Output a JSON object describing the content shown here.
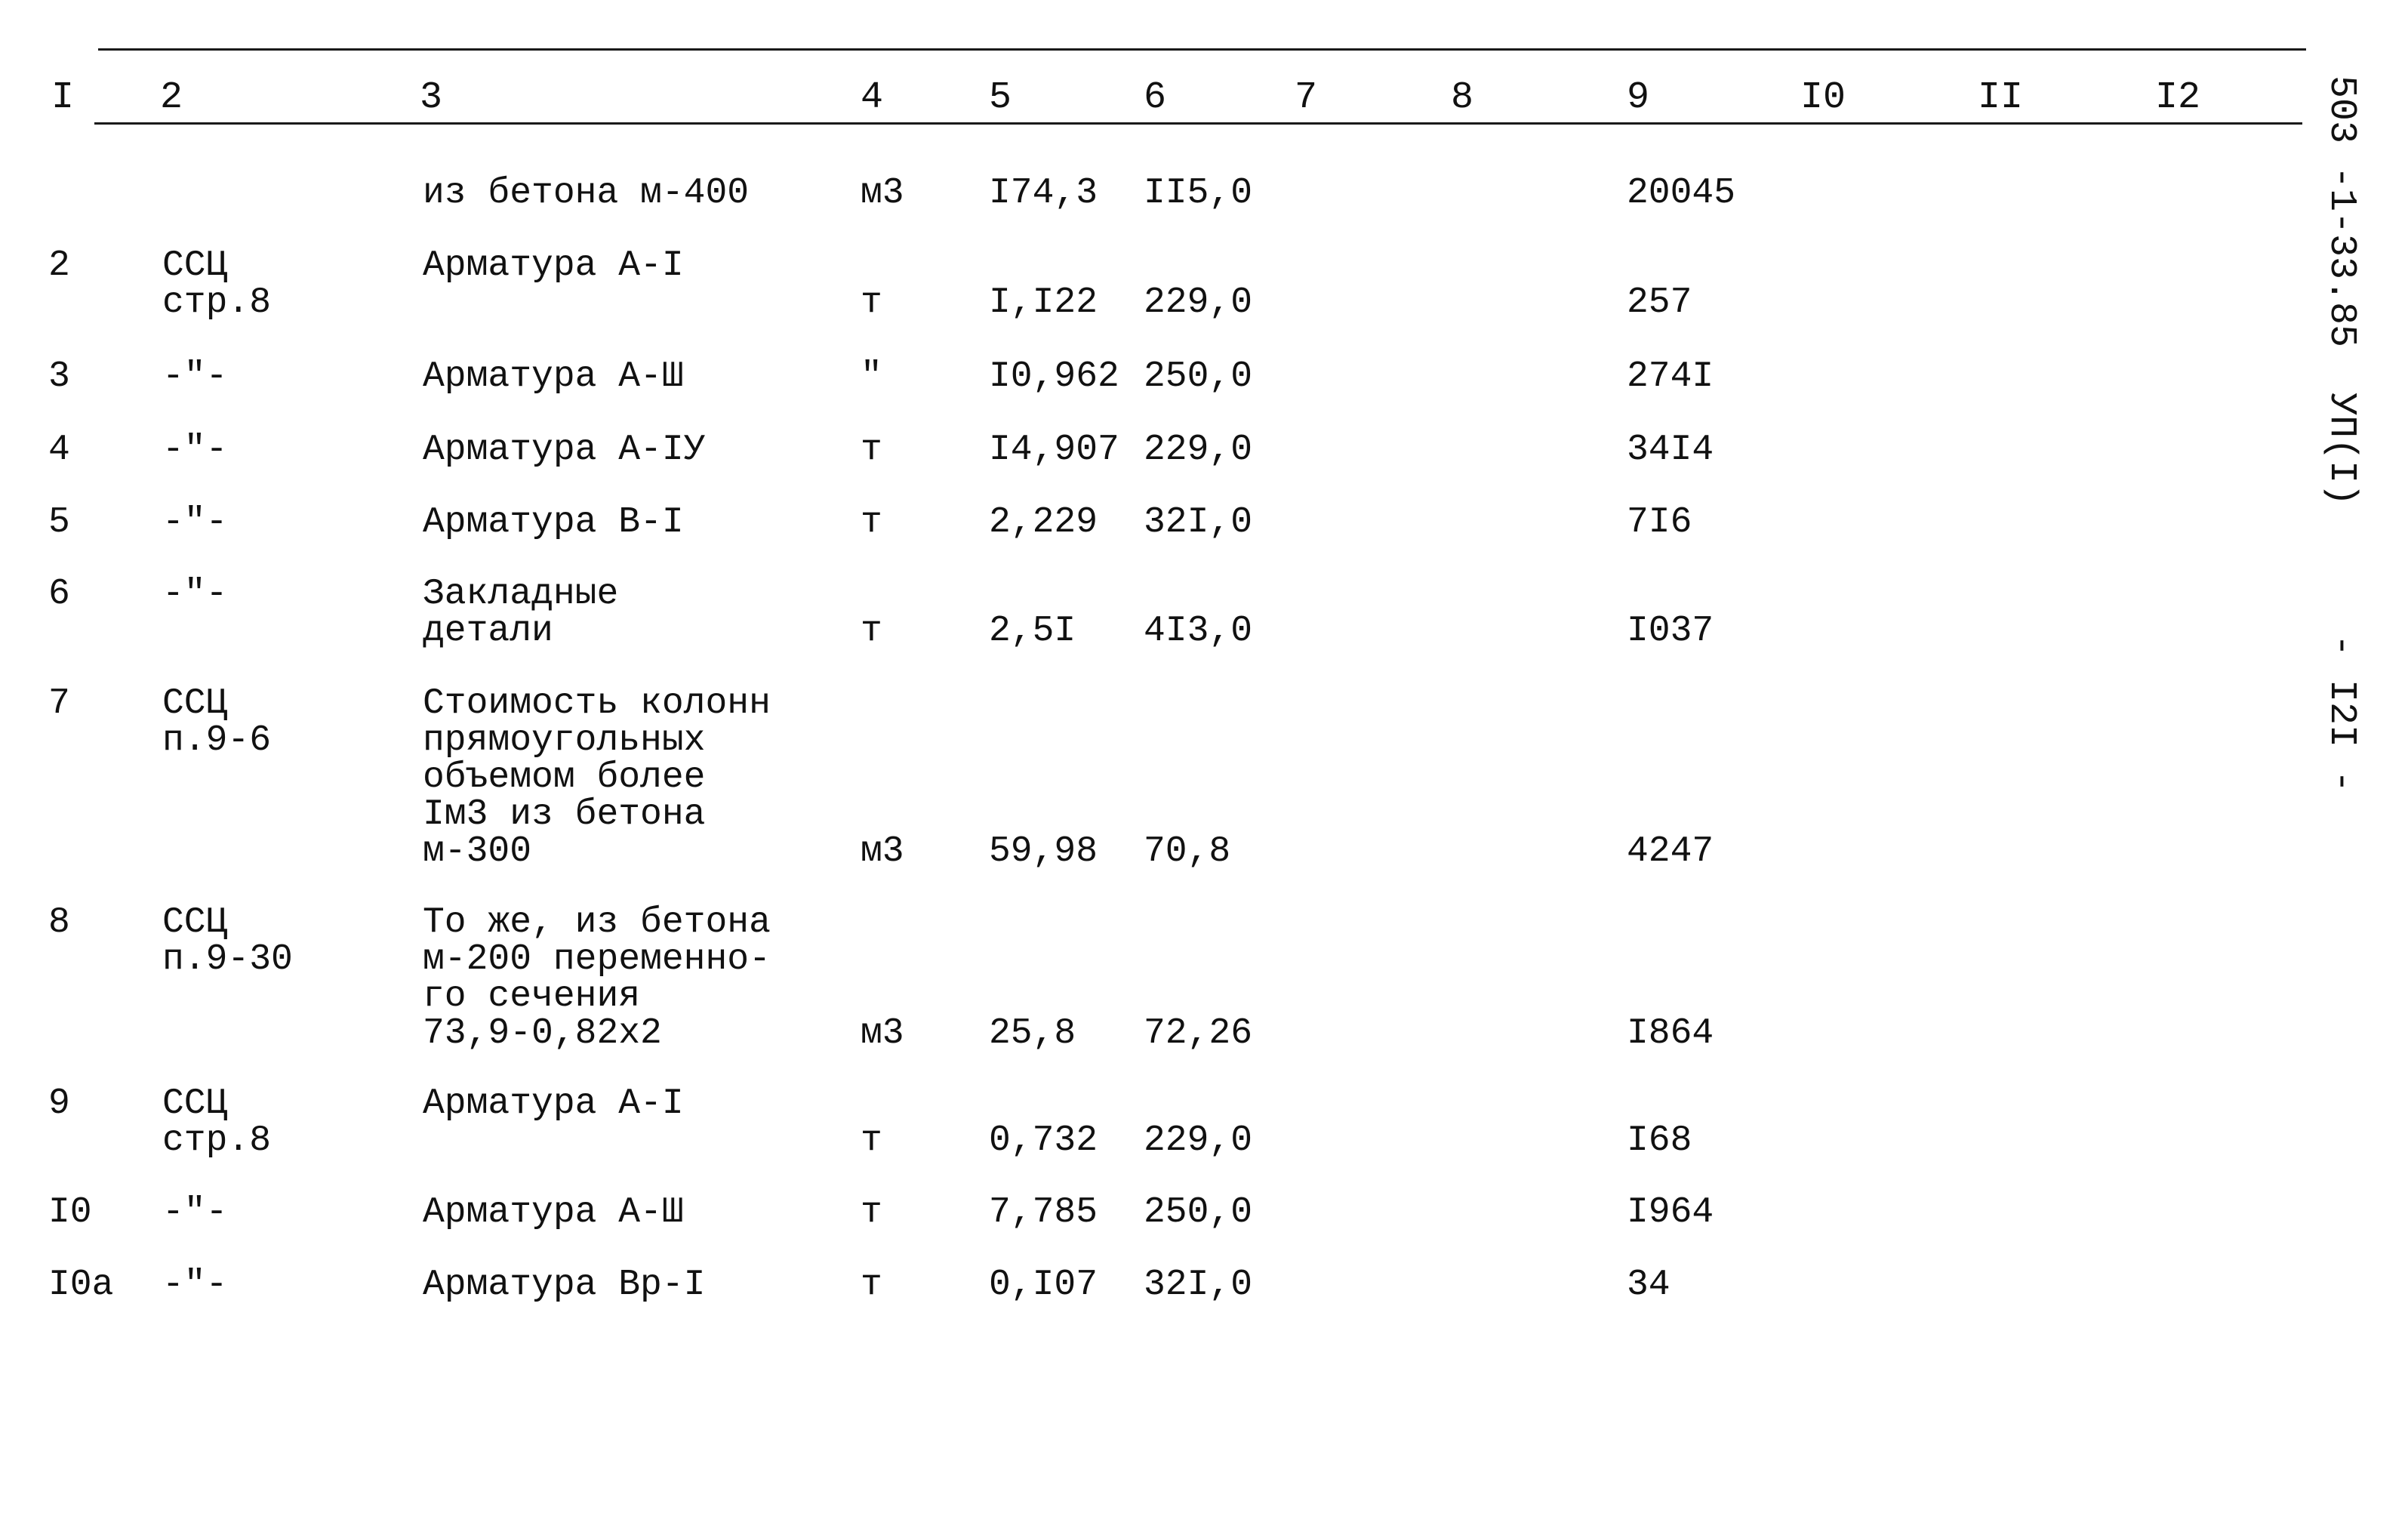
{
  "document": {
    "side_code": "503 -1-33.85  УП(I)",
    "page_number": "- I2I -",
    "column_headers": [
      "I",
      "2",
      "3",
      "4",
      "5",
      "6",
      "7",
      "8",
      "9",
      "I0",
      "II",
      "I2"
    ],
    "rows": [
      {
        "num": "",
        "ref": "",
        "name": "из бетона м-400",
        "unit": "м3",
        "qty": "I74,3",
        "price": "II5,0",
        "total": "20045"
      },
      {
        "num": "2",
        "ref": "ССЦ\nстр.8",
        "name": "Арматура А-I",
        "unit": "т",
        "qty": "I,I22",
        "price": "229,0",
        "total": "257"
      },
      {
        "num": "3",
        "ref": "-\"-",
        "name": "Арматура А-Ш",
        "unit": "\"",
        "qty": "I0,962",
        "price": "250,0",
        "total": "274I"
      },
      {
        "num": "4",
        "ref": "-\"-",
        "name": "Арматура А-IУ",
        "unit": "т",
        "qty": "I4,907",
        "price": "229,0",
        "total": "34I4"
      },
      {
        "num": "5",
        "ref": "-\"-",
        "name": "Арматура В-I",
        "unit": "т",
        "qty": "2,229",
        "price": "32I,0",
        "total": "7I6"
      },
      {
        "num": "6",
        "ref": "-\"-",
        "name": "Закладные\nдетали",
        "unit": "т",
        "qty": "2,5I",
        "price": "4I3,0",
        "total": "I037"
      },
      {
        "num": "7",
        "ref": "ССЦ\nп.9-6",
        "name": "Стоимость колонн\nпрямоугольных\nобъемом более\nIм3 из бетона\nм-300",
        "unit": "м3",
        "qty": "59,98",
        "price": "70,8",
        "total": "4247"
      },
      {
        "num": "8",
        "ref": "ССЦ\nп.9-30",
        "name": "То же, из бетона\nм-200 переменно-\nго сечения\n73,9-0,82х2",
        "unit": "м3",
        "qty": "25,8",
        "price": "72,26",
        "total": "I864"
      },
      {
        "num": "9",
        "ref": "ССЦ\nстр.8",
        "name": "Арматура А-I",
        "unit": "т",
        "qty": "0,732",
        "price": "229,0",
        "total": "I68"
      },
      {
        "num": "I0",
        "ref": "-\"-",
        "name": "Арматура А-Ш",
        "unit": "т",
        "qty": "7,785",
        "price": "250,0",
        "total": "I964"
      },
      {
        "num": "I0а",
        "ref": "-\"-",
        "name": "Арматура Вр-I",
        "unit": "т",
        "qty": "0,I07",
        "price": "32I,0",
        "total": "34"
      }
    ]
  }
}
